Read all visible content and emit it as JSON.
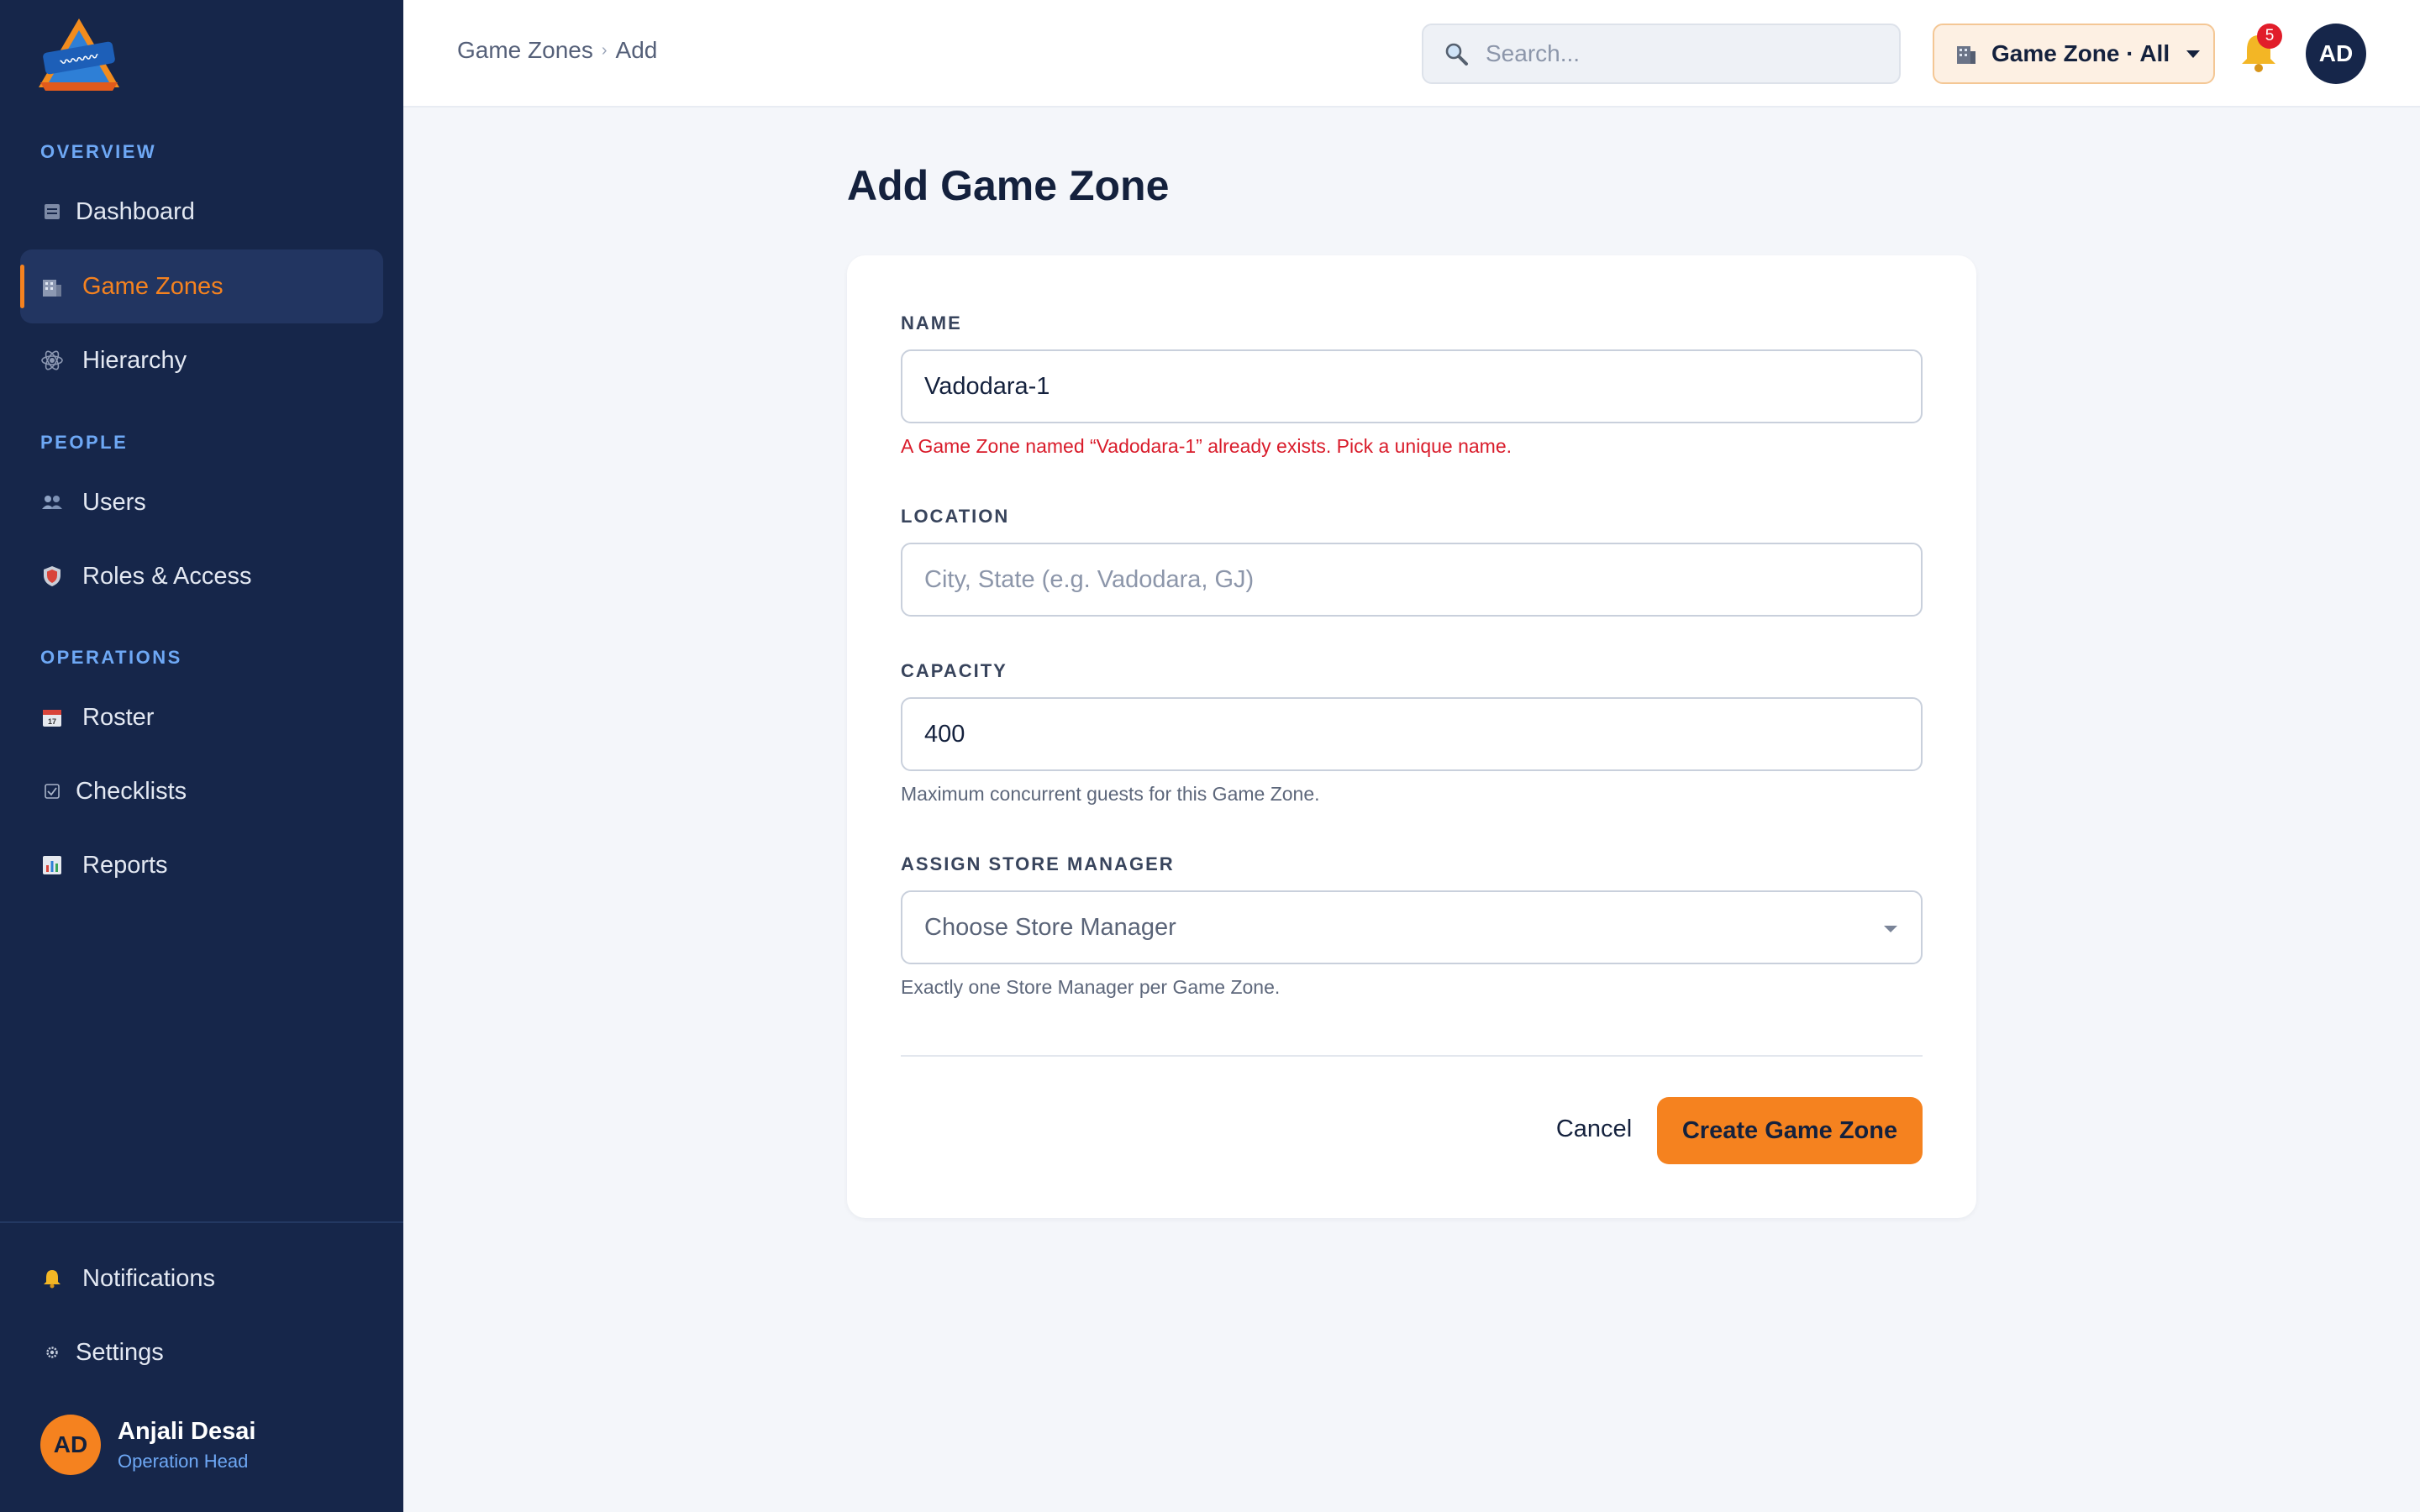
{
  "sidebar": {
    "sections": [
      {
        "title": "OVERVIEW"
      },
      {
        "title": "PEOPLE"
      },
      {
        "title": "OPERATIONS"
      }
    ],
    "items": [
      {
        "label": "Dashboard",
        "icon": "dashboard-icon"
      },
      {
        "label": "Game Zones",
        "icon": "building-icon",
        "active": true
      },
      {
        "label": "Hierarchy",
        "icon": "hierarchy-icon"
      },
      {
        "label": "Users",
        "icon": "users-icon"
      },
      {
        "label": "Roles & Access",
        "icon": "shield-icon"
      },
      {
        "label": "Roster",
        "icon": "calendar-icon"
      },
      {
        "label": "Checklists",
        "icon": "checkbox-icon"
      },
      {
        "label": "Reports",
        "icon": "bar-chart-icon"
      }
    ],
    "footer_items": [
      {
        "label": "Notifications",
        "icon": "bell-icon"
      },
      {
        "label": "Settings",
        "icon": "gear-icon"
      }
    ],
    "user": {
      "initials": "AD",
      "name": "Anjali Desai",
      "role": "Operation Head"
    }
  },
  "topbar": {
    "breadcrumb": [
      "Game Zones",
      "Add"
    ],
    "search_placeholder": "Search...",
    "zone_selector": "Game Zone · All",
    "notification_count": "5",
    "avatar_initials": "AD"
  },
  "page": {
    "title": "Add Game Zone",
    "form": {
      "name": {
        "label": "NAME",
        "value": "Vadodara-1",
        "error": "A Game Zone named “Vadodara-1” already exists. Pick a unique name."
      },
      "location": {
        "label": "LOCATION",
        "placeholder": "City, State (e.g. Vadodara, GJ)",
        "value": ""
      },
      "capacity": {
        "label": "CAPACITY",
        "value": "400",
        "help": "Maximum concurrent guests for this Game Zone."
      },
      "store_manager": {
        "label": "ASSIGN STORE MANAGER",
        "placeholder": "Choose Store Manager",
        "help": "Exactly one Store Manager per Game Zone."
      }
    },
    "actions": {
      "cancel": "Cancel",
      "submit": "Create Game Zone"
    }
  },
  "colors": {
    "sidebar_bg": "#16264a",
    "accent": "#f5821f",
    "error": "#d91c2b",
    "section_title": "#6ea8f5"
  }
}
